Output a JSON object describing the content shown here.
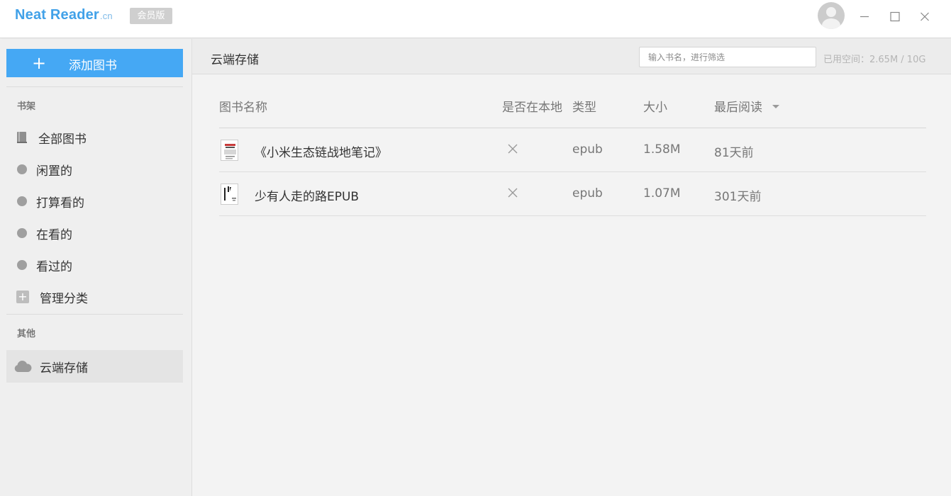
{
  "app": {
    "logo_main": "Neat Reader",
    "logo_suffix": ".cn",
    "vip_badge": "会员版"
  },
  "sidebar": {
    "add_button_plus": "+",
    "add_button_label": "添加图书",
    "shelf_section": "书架",
    "items": [
      {
        "label": "全部图书",
        "icon": "book-icon"
      },
      {
        "label": "闲置的",
        "icon": "dot-icon"
      },
      {
        "label": "打算看的",
        "icon": "dot-icon"
      },
      {
        "label": "在看的",
        "icon": "dot-icon"
      },
      {
        "label": "看过的",
        "icon": "dot-icon"
      },
      {
        "label": "管理分类",
        "icon": "plus-box-icon"
      }
    ],
    "other_section": "其他",
    "cloud_item": {
      "label": "云端存储",
      "icon": "cloud-icon"
    }
  },
  "main": {
    "title": "云端存储",
    "search_placeholder": "输入书名，进行筛选",
    "usage": "已用空间：2.65M / 10G",
    "columns": [
      "图书名称",
      "是否在本地",
      "类型",
      "大小",
      "最后阅读"
    ],
    "rows": [
      {
        "title": "《小米生态链战地笔记》",
        "local": "×",
        "type": "epub",
        "size": "1.58M",
        "last_read": "81天前"
      },
      {
        "title": "少有人走的路EPUB",
        "local": "×",
        "type": "epub",
        "size": "1.07M",
        "last_read": "301天前"
      }
    ]
  },
  "colors": {
    "accent": "#45a8f4",
    "logo": "#41a1e8",
    "sidebar_bg": "#efefef",
    "active_item_bg": "#e4e4e4"
  }
}
